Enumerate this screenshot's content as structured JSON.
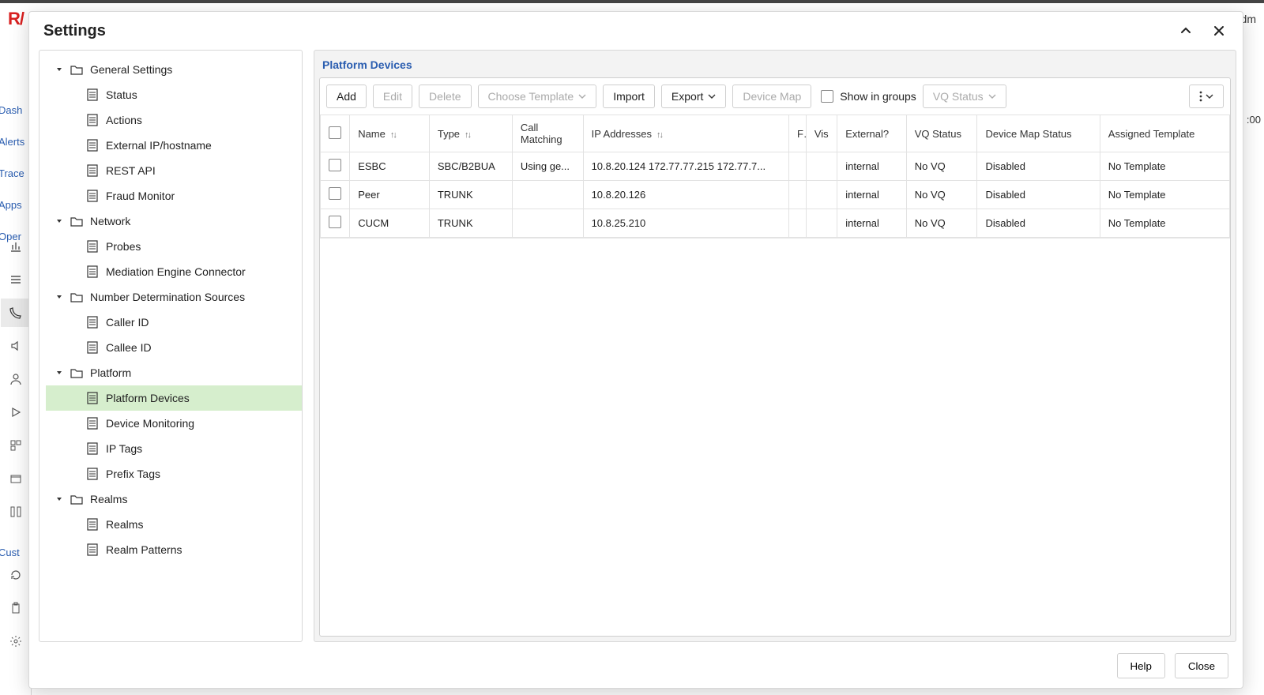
{
  "bg": {
    "logo_text": "R/",
    "user": "adm",
    "clock": ":00",
    "leftnav": [
      "Dash",
      "Alerts",
      "Trace",
      "Apps",
      "Oper",
      "Cust"
    ]
  },
  "dialog": {
    "title": "Settings",
    "help": "Help",
    "close": "Close"
  },
  "sidebar": {
    "groups": [
      {
        "label": "General Settings",
        "items": [
          "Status",
          "Actions",
          "External IP/hostname",
          "REST API",
          "Fraud Monitor"
        ]
      },
      {
        "label": "Network",
        "items": [
          "Probes",
          "Mediation Engine Connector"
        ]
      },
      {
        "label": "Number Determination Sources",
        "items": [
          "Caller ID",
          "Callee ID"
        ]
      },
      {
        "label": "Platform",
        "items": [
          "Platform Devices",
          "Device Monitoring",
          "IP Tags",
          "Prefix Tags"
        ],
        "selected_index": 0
      },
      {
        "label": "Realms",
        "items": [
          "Realms",
          "Realm Patterns"
        ]
      }
    ]
  },
  "panel": {
    "title": "Platform Devices"
  },
  "toolbar": {
    "add": "Add",
    "edit": "Edit",
    "delete": "Delete",
    "choose_template": "Choose Template",
    "import": "Import",
    "export": "Export",
    "device_map": "Device Map",
    "show_in_groups": "Show in groups",
    "vq_status": "VQ Status"
  },
  "table": {
    "columns": {
      "name": "Name",
      "type": "Type",
      "call_matching": "Call Matching",
      "ip": "IP Addresses",
      "narrow": "F",
      "vis": "Vis",
      "external": "External?",
      "vq_status": "VQ Status",
      "dms": "Device Map Status",
      "template": "Assigned Template"
    },
    "rows": [
      {
        "name": "ESBC",
        "type": "SBC/B2BUA",
        "call_matching": "Using ge...",
        "ip": "10.8.20.124 172.77.77.215 172.77.7...",
        "external": "internal",
        "vq": "No VQ",
        "dms": "Disabled",
        "template": "No Template"
      },
      {
        "name": "Peer",
        "type": "TRUNK",
        "call_matching": "",
        "ip": "10.8.20.126",
        "external": "internal",
        "vq": "No VQ",
        "dms": "Disabled",
        "template": "No Template"
      },
      {
        "name": "CUCM",
        "type": "TRUNK",
        "call_matching": "",
        "ip": "10.8.25.210",
        "external": "internal",
        "vq": "No VQ",
        "dms": "Disabled",
        "template": "No Template"
      }
    ]
  }
}
